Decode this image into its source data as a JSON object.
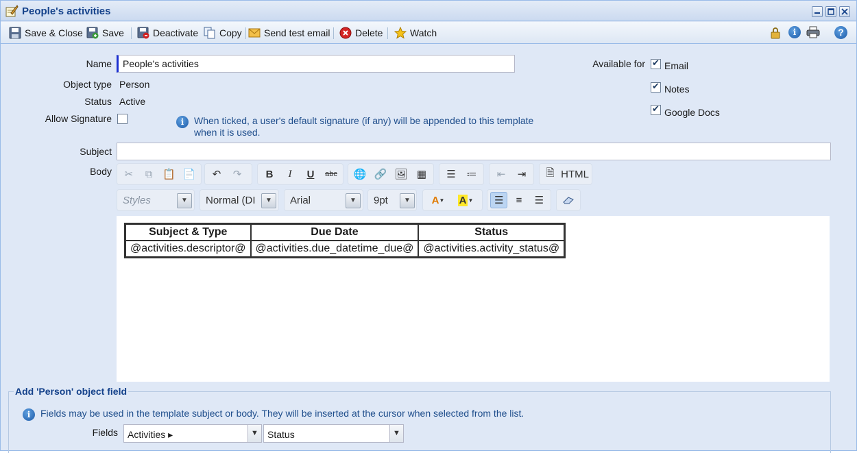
{
  "window": {
    "title": "People's activities"
  },
  "toolbar": {
    "save_close": "Save & Close",
    "save": "Save",
    "deactivate": "Deactivate",
    "copy": "Copy",
    "send_test_email": "Send test email",
    "delete": "Delete",
    "watch": "Watch"
  },
  "form": {
    "name_label": "Name",
    "name_value": "People's activities",
    "object_type_label": "Object type",
    "object_type_value": "Person",
    "status_label": "Status",
    "status_value": "Active",
    "allow_signature_label": "Allow Signature",
    "allow_signature_checked": false,
    "signature_hint_line1": "When ticked, a user's default signature (if any) will be appended to this template",
    "signature_hint_line2": "when it is used.",
    "available_for_label": "Available for",
    "available_for": [
      {
        "label": "Email",
        "checked": true
      },
      {
        "label": "Notes",
        "checked": true
      },
      {
        "label": "Google Docs",
        "checked": true
      }
    ],
    "subject_label": "Subject",
    "subject_value": "",
    "body_label": "Body"
  },
  "editor": {
    "html_label": "HTML",
    "styles_placeholder": "Styles",
    "format_value": "Normal (DI",
    "font_value": "Arial",
    "size_value": "9pt",
    "table": {
      "headers": [
        "Subject & Type",
        "Due Date",
        "Status"
      ],
      "row": [
        "@activities.descriptor@",
        "@activities.due_datetime_due@",
        "@activities.activity_status@"
      ]
    }
  },
  "fields_panel": {
    "legend": "Add 'Person' object field",
    "hint": "Fields may be used in the template subject or body. They will be inserted at the cursor when selected from the list.",
    "fields_label": "Fields",
    "field_value": "Activities ▸",
    "subfield_value": "Status"
  },
  "colors": {
    "title_text": "#15428b",
    "frame_bg": "#dfe8f6",
    "hint_text": "#1f4e8c"
  }
}
